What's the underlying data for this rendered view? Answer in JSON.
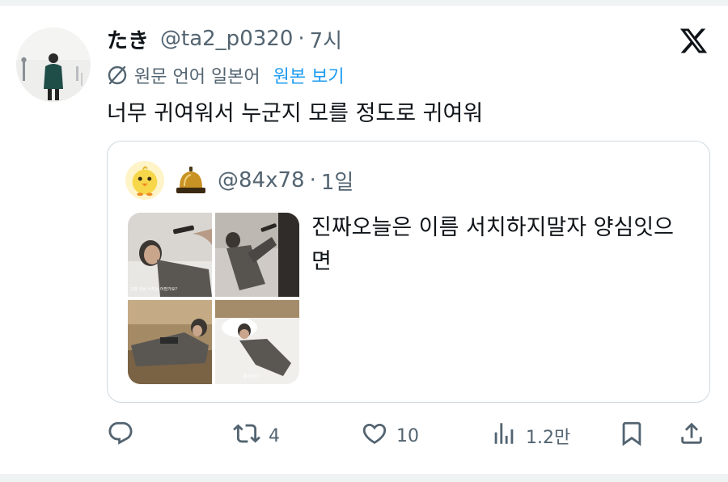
{
  "tweet": {
    "display_name": "たき",
    "handle": "@ta2_p0320",
    "separator": "·",
    "time": "7시",
    "translation_note": "원문 언어 일본어",
    "show_original": "원본 보기",
    "text": "너무 귀여워서 누군지 모를 정도로 귀여워"
  },
  "quote": {
    "handle": "@84x78",
    "separator": "·",
    "time": "1일",
    "text": "진짜오늘은 이름 서치하지말자 양심잇으면",
    "media_captions": [
      "오늘 지금 수치는 어떤가요?",
      "...통하여(?)"
    ]
  },
  "actions": {
    "reply_count": "",
    "retweet_count": "4",
    "like_count": "10",
    "view_count": "1.2만"
  },
  "icons": {
    "logo": "x-logo-icon",
    "translate": "translate-icon",
    "reply": "reply-icon",
    "retweet": "retweet-icon",
    "like": "heart-icon",
    "views": "views-icon",
    "bookmark": "bookmark-icon",
    "share": "share-icon"
  },
  "colors": {
    "text_primary": "#0f1419",
    "text_secondary": "#536471",
    "accent": "#1d9bf0",
    "border": "#cfd9de"
  }
}
